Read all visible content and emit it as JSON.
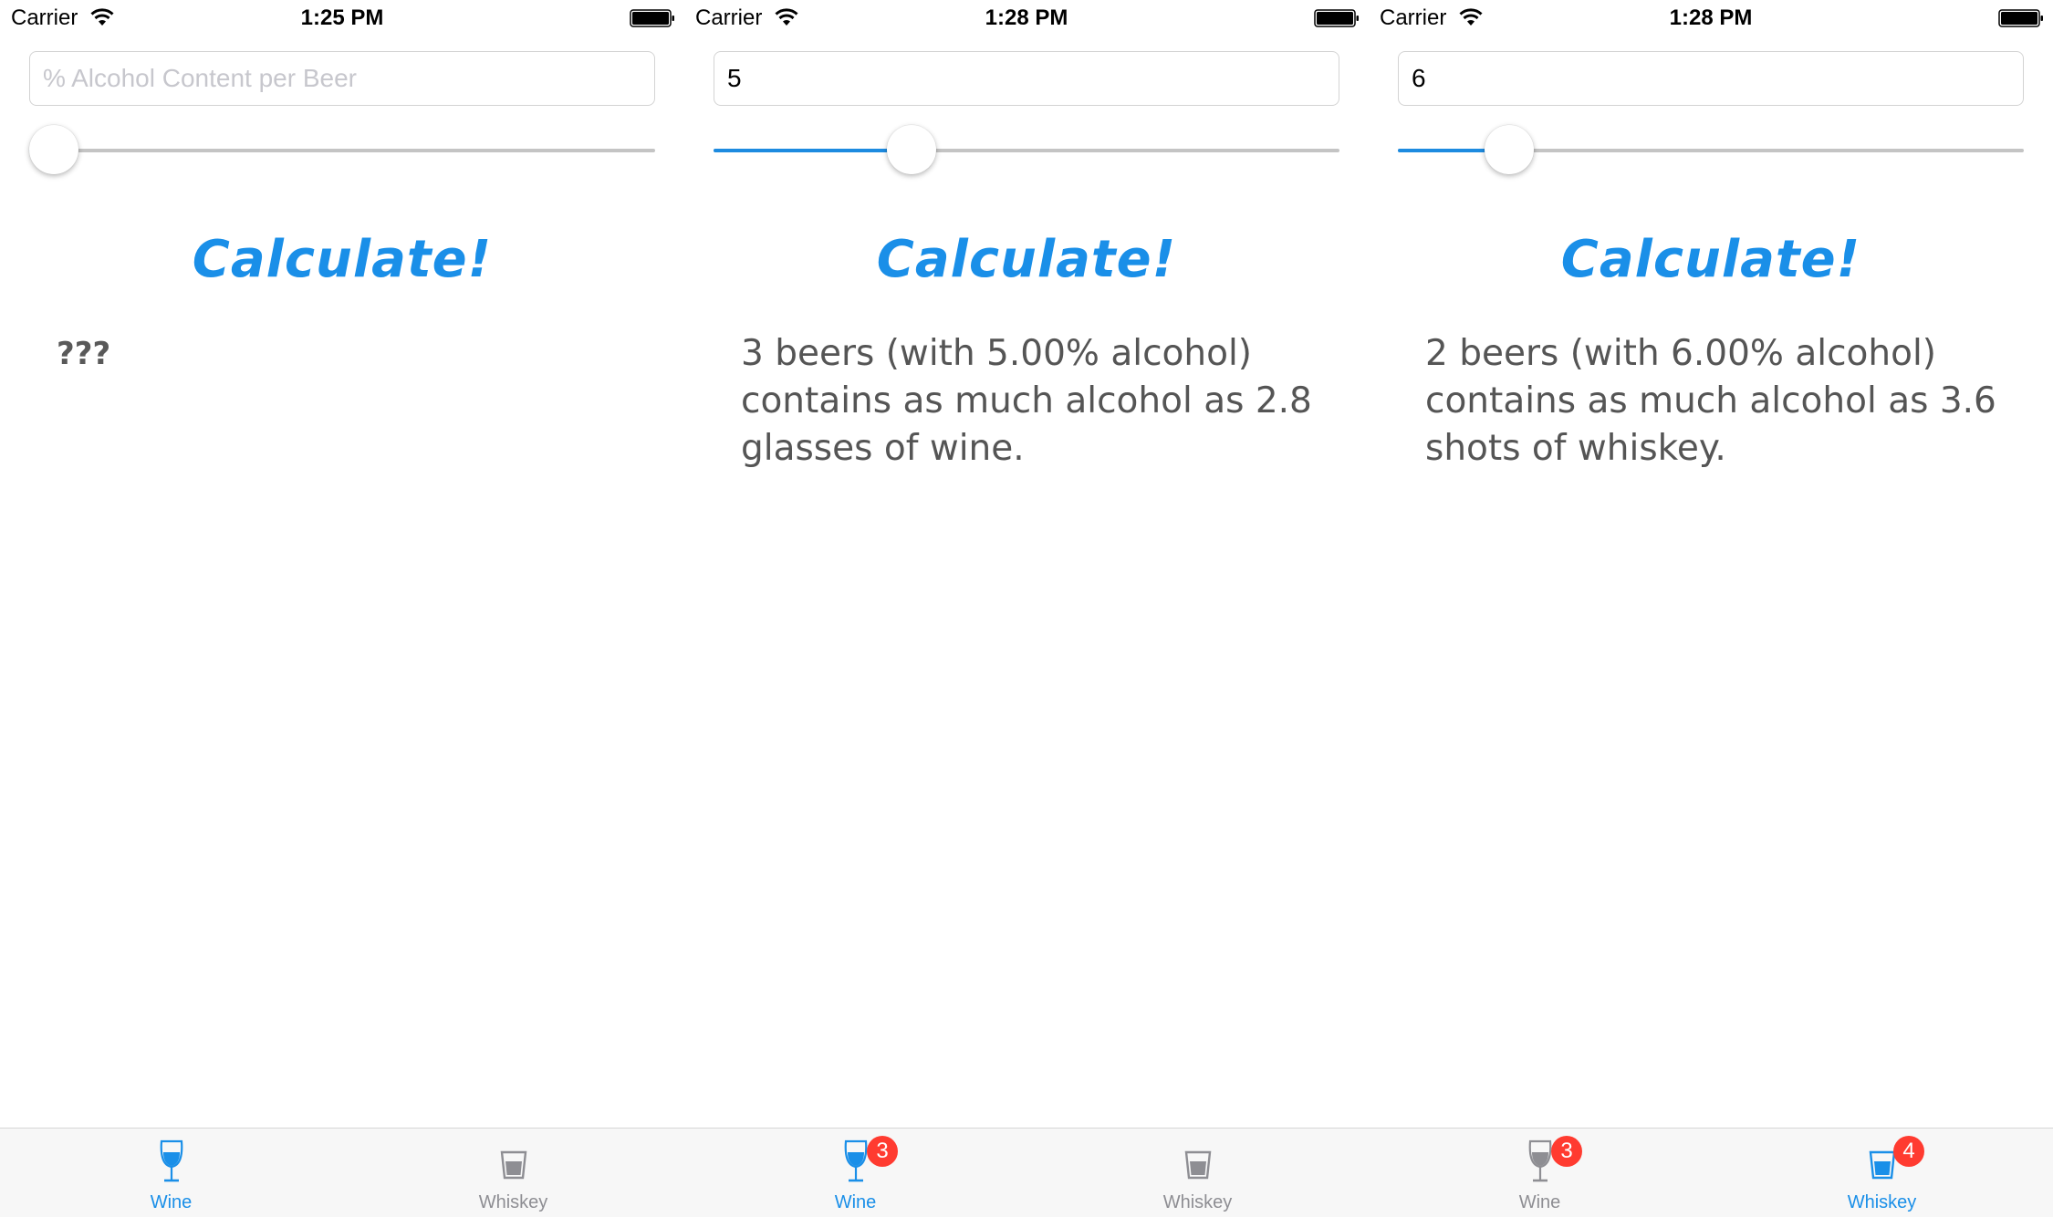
{
  "colors": {
    "accent": "#1a8fe8",
    "inactive": "#8e8e93",
    "badge": "#ff3b30"
  },
  "screens": [
    {
      "status": {
        "carrier": "Carrier",
        "time": "1:25 PM"
      },
      "input": {
        "value": "",
        "placeholder": "% Alcohol Content per Beer"
      },
      "slider": {
        "value": 0
      },
      "calculate_label": "Calculate!",
      "result": "???",
      "tabs": [
        {
          "label": "Wine",
          "icon": "wine-glass-icon",
          "active": true,
          "badge": ""
        },
        {
          "label": "Whiskey",
          "icon": "shot-glass-icon",
          "active": false,
          "badge": ""
        }
      ]
    },
    {
      "status": {
        "carrier": "Carrier",
        "time": "1:28 PM"
      },
      "input": {
        "value": "5",
        "placeholder": "% Alcohol Content per Beer"
      },
      "slider": {
        "value": 0.3
      },
      "calculate_label": "Calculate!",
      "result": "3 beers (with 5.00% alcohol) contains as much alcohol as 2.8 glasses of wine.",
      "tabs": [
        {
          "label": "Wine",
          "icon": "wine-glass-icon",
          "active": true,
          "badge": "3"
        },
        {
          "label": "Whiskey",
          "icon": "shot-glass-icon",
          "active": false,
          "badge": ""
        }
      ]
    },
    {
      "status": {
        "carrier": "Carrier",
        "time": "1:28 PM"
      },
      "input": {
        "value": "6",
        "placeholder": "% Alcohol Content per Beer"
      },
      "slider": {
        "value": 0.15
      },
      "calculate_label": "Calculate!",
      "result": "2 beers (with 6.00% alcohol) contains as much alcohol as 3.6 shots of whiskey.",
      "tabs": [
        {
          "label": "Wine",
          "icon": "wine-glass-icon",
          "active": false,
          "badge": "3"
        },
        {
          "label": "Whiskey",
          "icon": "shot-glass-icon",
          "active": true,
          "badge": "4"
        }
      ]
    }
  ]
}
